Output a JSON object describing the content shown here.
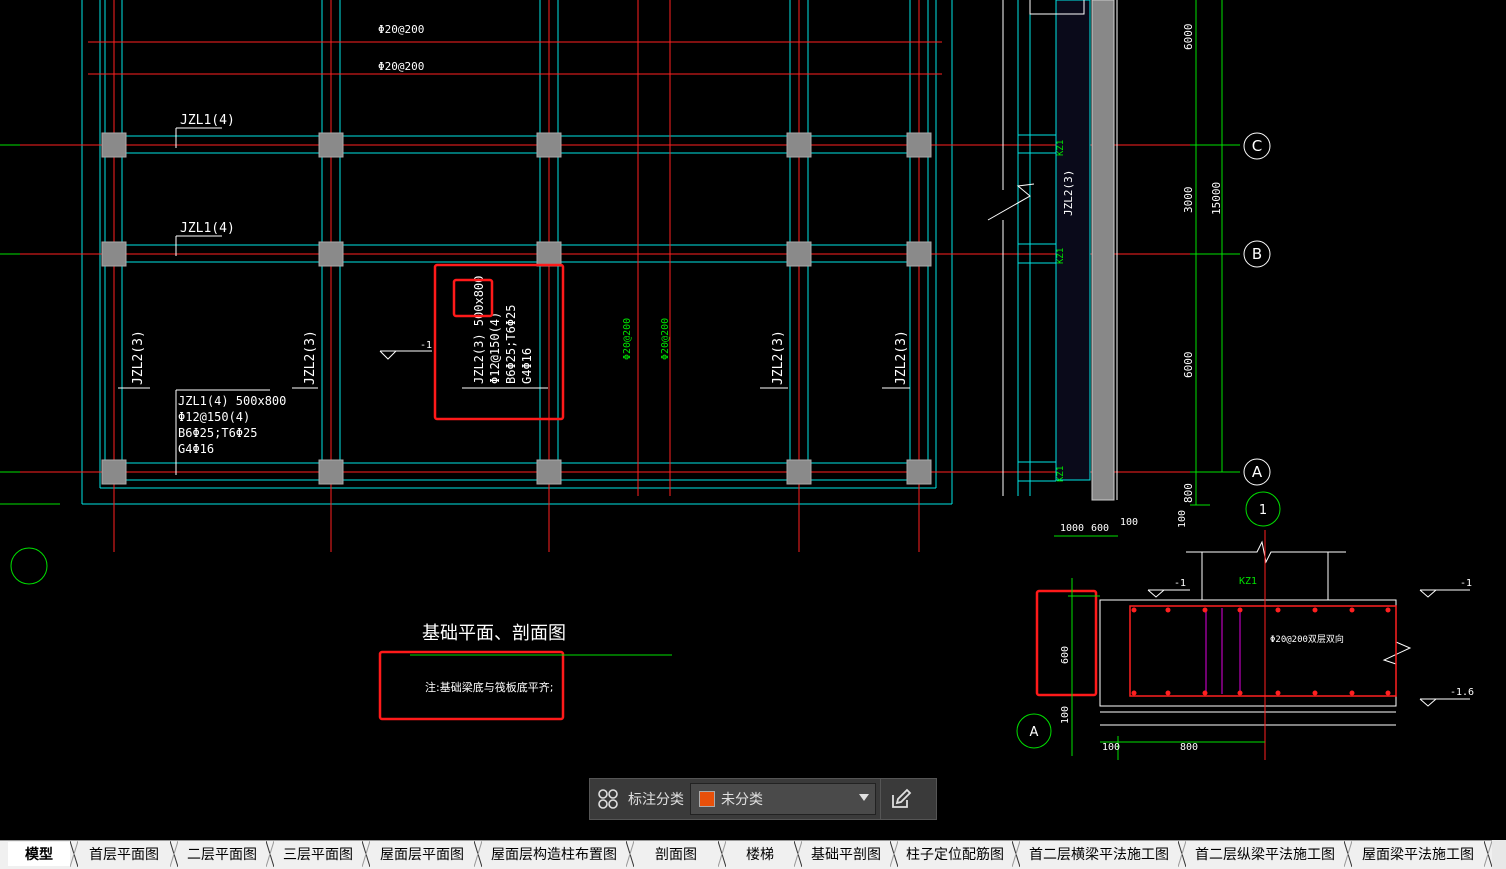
{
  "drawing": {
    "labels": {
      "rebar_top_1": "Φ20@200",
      "rebar_top_2": "Φ20@200",
      "jzl1_a": "JZL1(4)",
      "jzl1_b": "JZL1(4)",
      "jzl2_1": "JZL2(3)",
      "jzl2_2": "JZL2(3)",
      "jzl2_4": "JZL2(3)",
      "jzl2_5": "JZL2(3)",
      "jzl1_spec_1": "JZL1(4) 500x800",
      "jzl1_spec_2": "Φ12@150(4)",
      "jzl1_spec_3": "B6Φ25;T6Φ25",
      "jzl1_spec_4": "G4Φ16",
      "jzl2_spec_1": "JZL2(3) 500x800",
      "jzl2_spec_2": "Φ12@150(4)",
      "jzl2_spec_3": "B6Φ25;T6Φ25",
      "jzl2_spec_4": "G4Φ16",
      "green_rebar_1": "Φ20@200",
      "green_rebar_2": "Φ20@200",
      "level_minus1": "-1",
      "title": "基础平面、剖面图",
      "note": "注:基础梁底与筏板底平齐;",
      "dim_6000_top": "6000",
      "dim_3000": "3000",
      "dim_15000": "15000",
      "dim_6000_mid": "6000",
      "dim_800": "800",
      "dim_100_v": "100",
      "dim_1000": "1000",
      "dim_600_h": "600",
      "dim_100_h": "100",
      "axis_c": "C",
      "axis_b": "B",
      "axis_a": "A",
      "axis_1": "1",
      "axis_a_section": "A",
      "kz1_1": "KZ1",
      "kz1_2": "KZ1",
      "kz1_3": "KZ1",
      "jzl2_side": "JZL2(3)",
      "sec_kz1": "KZ1",
      "sec_minus1_left": "-1",
      "sec_minus1_right": "-1",
      "sec_minus16": "-1.6",
      "sec_rebar": "Φ20@200双层双向",
      "sec_600": "600",
      "sec_100_v": "100",
      "sec_100_h": "100",
      "sec_800": "800"
    }
  },
  "toolbar": {
    "category_label": "标注分类",
    "selected_category": "未分类",
    "swatch_color": "#e8500a"
  },
  "tabs": [
    {
      "label": "模型",
      "active": true
    },
    {
      "label": "首层平面图"
    },
    {
      "label": "二层平面图"
    },
    {
      "label": "三层平面图"
    },
    {
      "label": "屋面层平面图"
    },
    {
      "label": "屋面层构造柱布置图"
    },
    {
      "label": "剖面图"
    },
    {
      "label": "楼梯"
    },
    {
      "label": "基础平剖图"
    },
    {
      "label": "柱子定位配筋图"
    },
    {
      "label": "首二层横梁平法施工图"
    },
    {
      "label": "首二层纵梁平法施工图"
    },
    {
      "label": "屋面梁平法施工图"
    }
  ],
  "colors": {
    "cyan": "#00e5e5",
    "red": "#ff2020",
    "green": "#00e000",
    "white": "#ffffff",
    "highlight": "#ff1a1a",
    "magenta": "#e000e0"
  }
}
